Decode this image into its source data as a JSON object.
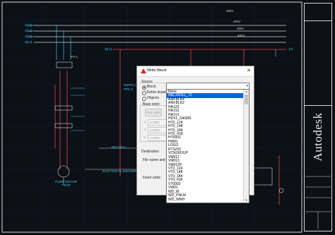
{
  "drawing": {
    "bus_labels": [
      "3L1",
      "3L2",
      "3L3",
      "3L4"
    ],
    "top_labels": [
      "400V",
      "400V",
      "400V",
      "400V"
    ],
    "left_labels": [
      "3(L1)",
      "3(L2)",
      "3(L3)",
      "3(L4)"
    ],
    "mid_labels": [
      "3(L1)",
      "PV-1"
    ],
    "right_labels": [
      "X1",
      "X2",
      "X3",
      "X4",
      "1/4"
    ],
    "side_labels": [
      "SUPPLY",
      "PPE-3",
      "ELECTRICAL ENGINEERING",
      "DRIVE"
    ],
    "motor_label": "PUMP MOTOR\n7.5HP",
    "neutral_label": "NEUTRAL",
    "brand_name": "Autodesk",
    "colors": {
      "background": "#0c1017",
      "cyan": "#39c6e8",
      "red": "#e04848",
      "white": "#d8d8d8"
    }
  },
  "dialog": {
    "title": "Write Block",
    "source_label": "Source",
    "radio_block": "Block:",
    "radio_entire": "Entire drawing",
    "radio_objects": "Objects",
    "base_point_label": "Base point",
    "pick_point_label": "Pick point",
    "coord_x_label": "X:",
    "coord_x": "0.0000",
    "coord_y_label": "Y:",
    "coord_y": "0.0000",
    "coord_z_label": "Z:",
    "coord_z": "0.0000",
    "destination_label": "Destination",
    "file_label": "File name and path:",
    "insert_units_label": "Insert units:",
    "combo_value": "",
    "list_items": [
      "None",
      "A$C10DE1_72",
      "AIM-BLK4",
      "AIM-BLK2",
      "HA123",
      "HA1S1",
      "HA1V1",
      "HDV1_S4GM1",
      "HT0_124",
      "HT0_148",
      "HT0_184",
      "HT0_418",
      "HT0002",
      "HW01",
      "LOGO",
      "RTS201",
      "VCN1ROUP",
      "VM012",
      "VM013",
      "VM012P",
      "VT0_124",
      "VT0_148",
      "VT0_184",
      "VT0_418",
      "VT0002",
      "VW01",
      "WD_M",
      "WD_PNLM",
      "WD_WNH"
    ],
    "selected_index": 1
  }
}
